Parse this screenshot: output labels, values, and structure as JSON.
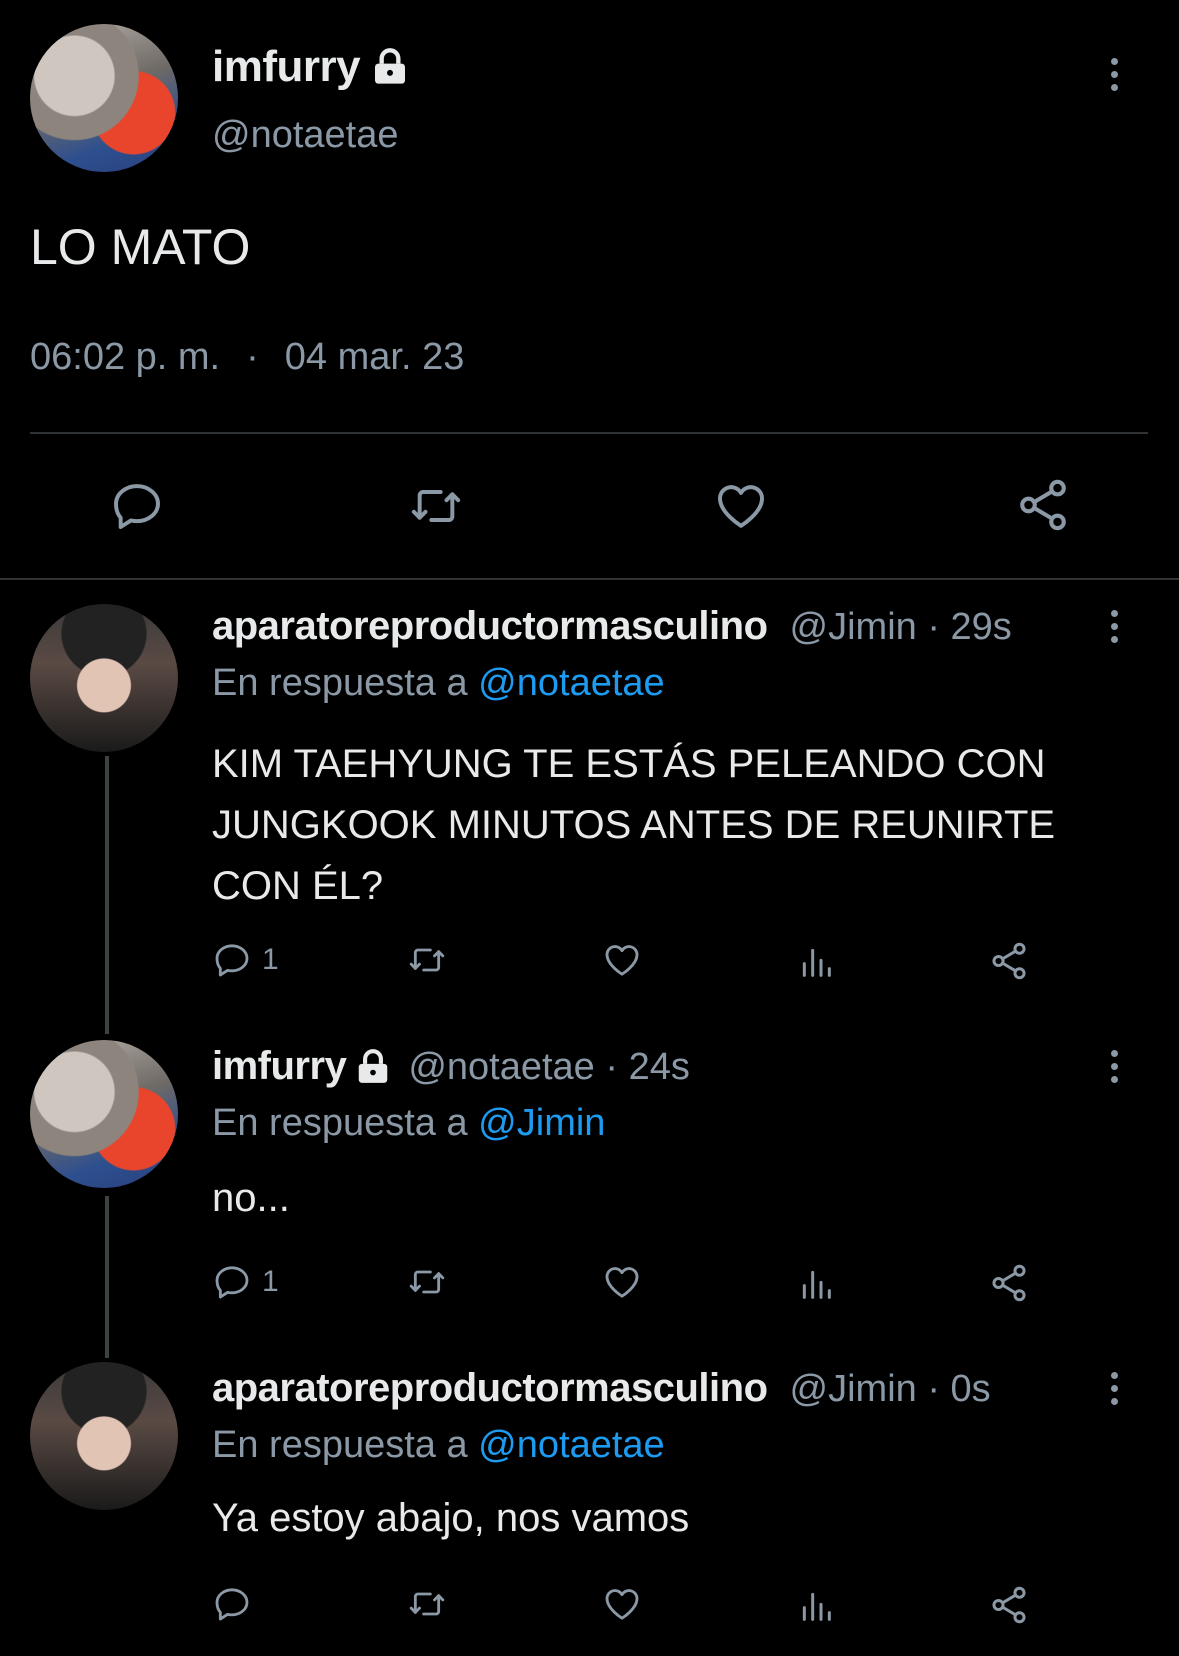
{
  "main_tweet": {
    "display_name": "imfurry",
    "handle": "@notaetae",
    "text": "LO MATO",
    "time": "06:02 p. m.",
    "separator": "·",
    "date": "04 mar. 23"
  },
  "replies": [
    {
      "display_name": "aparatoreproductormasculino",
      "handle_time": "@Jimin · 29s",
      "reply_prefix": "En respuesta a",
      "reply_to": "@notaetae",
      "text_lines": [
        "KIM TAEHYUNG TE ESTÁS PELEANDO CON",
        "JUNGKOOK MINUTOS ANTES DE REUNIRTE",
        "CON ÉL?"
      ],
      "reply_count": "1"
    },
    {
      "display_name": "imfurry",
      "handle_time": "@notaetae · 24s",
      "reply_prefix": "En respuesta a",
      "reply_to": "@Jimin",
      "text_lines": [
        "no..."
      ],
      "reply_count": "1"
    },
    {
      "display_name": "aparatoreproductormasculino",
      "handle_time": "@Jimin · 0s",
      "reply_prefix": "En respuesta a",
      "reply_to": "@notaetae",
      "text_lines": [
        "Ya estoy abajo, nos vamos"
      ],
      "reply_count": ""
    }
  ],
  "icons": {
    "reply": "reply-icon",
    "retweet": "retweet-icon",
    "like": "heart-icon",
    "share": "share-icon",
    "analytics": "analytics-icon",
    "lock": "lock-icon",
    "more": "more-icon"
  },
  "colors": {
    "background": "#000000",
    "text": "#e7e9ea",
    "muted": "#8b98a5",
    "link": "#1d9bf0"
  }
}
